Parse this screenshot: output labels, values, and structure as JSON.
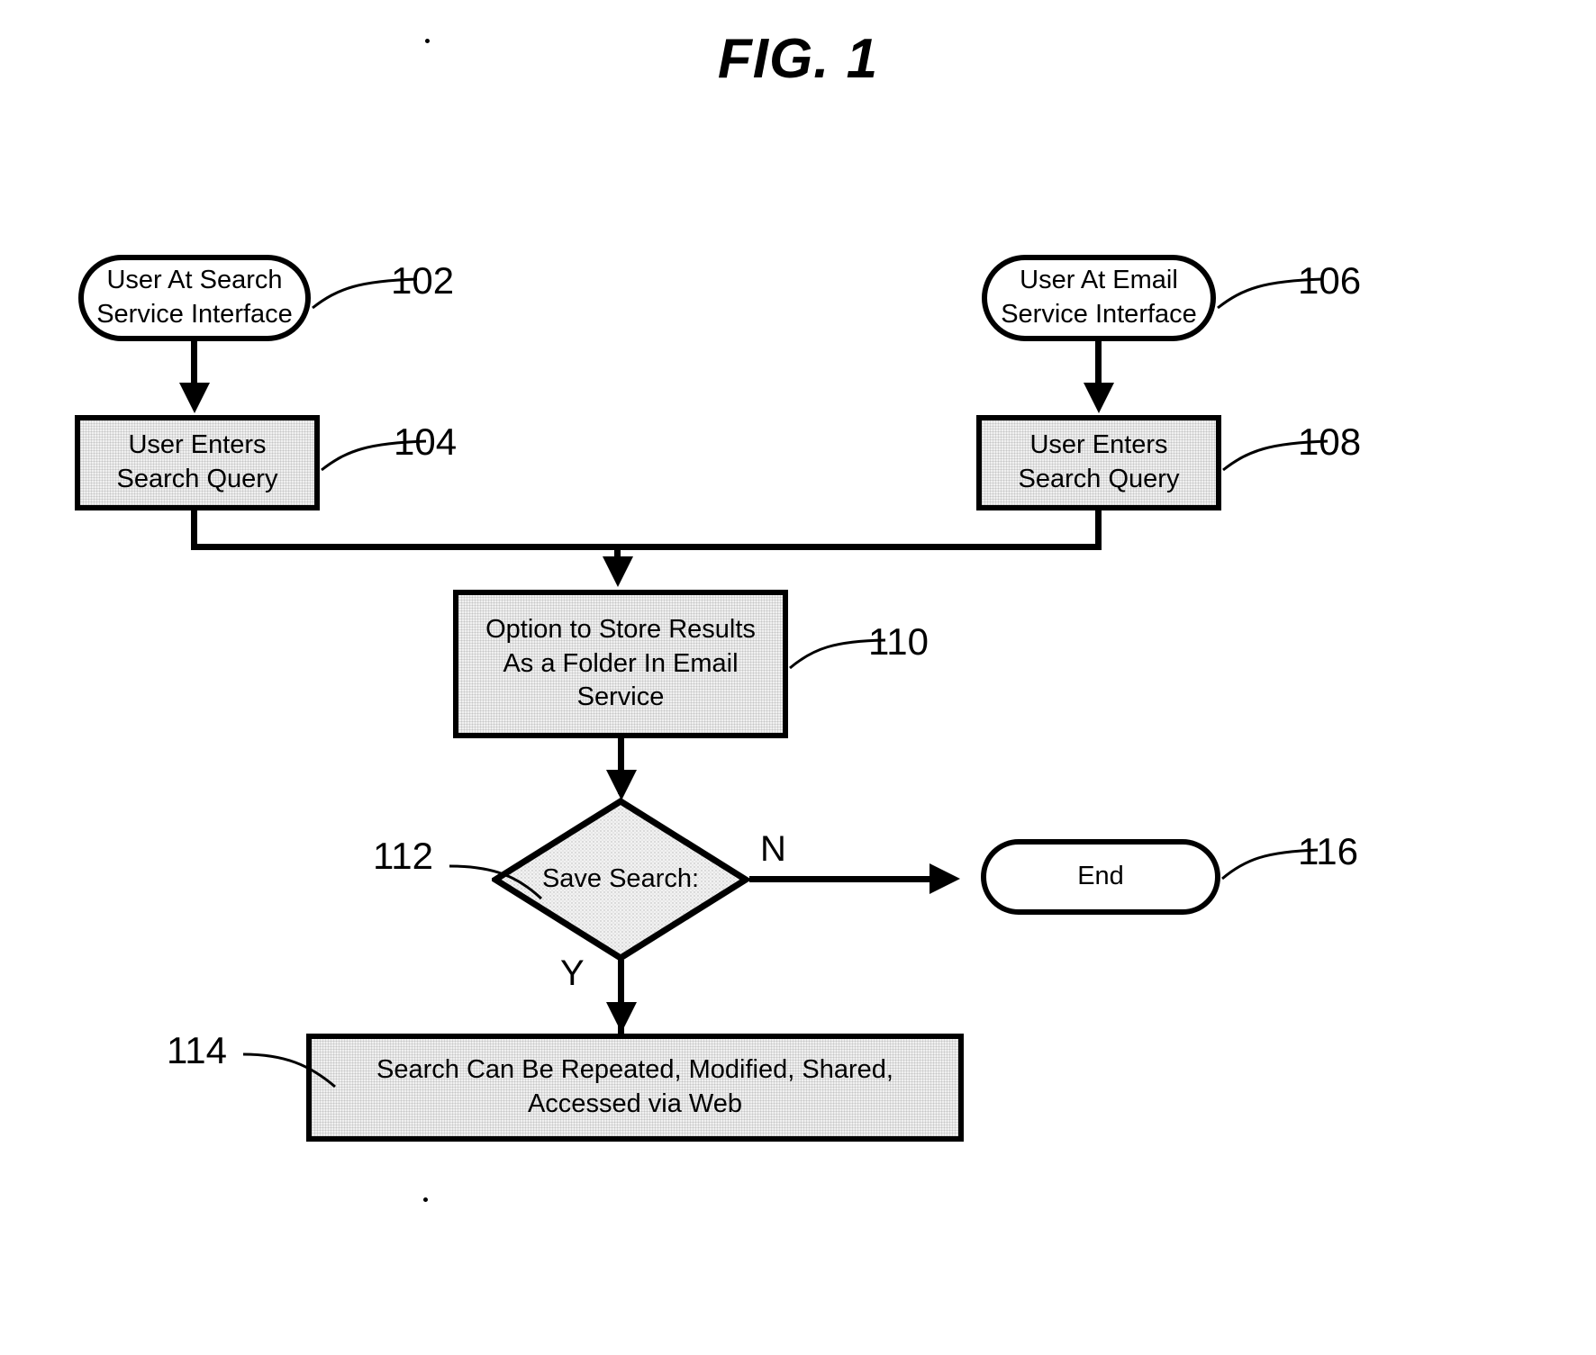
{
  "figure": {
    "title": "FIG. 1",
    "type": "flowchart"
  },
  "nodes": {
    "n102": {
      "ref": "102",
      "shape": "terminator",
      "text": "User At Search\nService Interface"
    },
    "n104": {
      "ref": "104",
      "shape": "process",
      "text": "User Enters\nSearch Query"
    },
    "n106": {
      "ref": "106",
      "shape": "terminator",
      "text": "User At Email\nService Interface"
    },
    "n108": {
      "ref": "108",
      "shape": "process",
      "text": "User Enters\nSearch Query"
    },
    "n110": {
      "ref": "110",
      "shape": "process",
      "text": "Option to Store Results\nAs a Folder In Email\nService"
    },
    "n112": {
      "ref": "112",
      "shape": "decision",
      "text": "Save Search:"
    },
    "n114": {
      "ref": "114",
      "shape": "process",
      "text": "Search Can Be Repeated, Modified, Shared,\nAccessed via Web"
    },
    "n116": {
      "ref": "116",
      "shape": "terminator",
      "text": "End"
    }
  },
  "branches": {
    "no": "N",
    "yes": "Y"
  },
  "colors": {
    "stroke": "#000000",
    "fill_process": "#f0f0f0",
    "background": "#ffffff"
  }
}
